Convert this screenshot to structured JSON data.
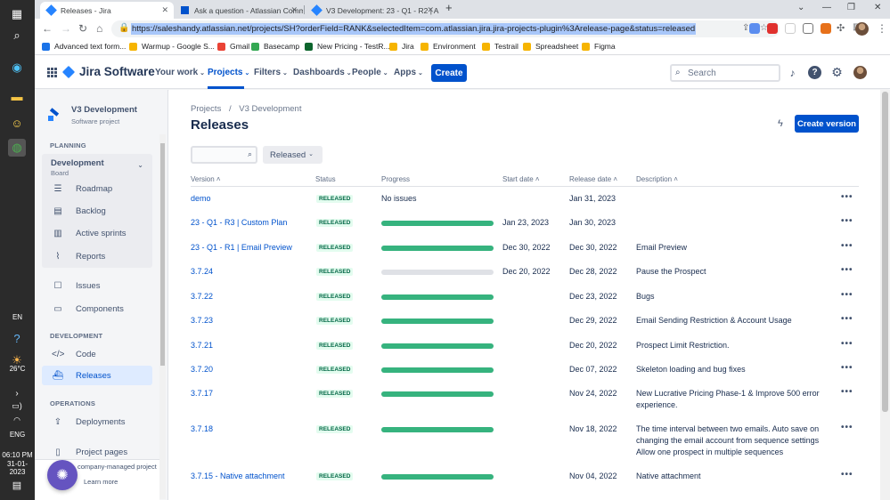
{
  "taskbar": {
    "weather": "26°C",
    "lang": "EN",
    "lang2": "ENG",
    "time": "06:10 PM",
    "date": "31-01-2023"
  },
  "browser": {
    "tabs": [
      {
        "label": "Releases - Jira",
        "active": true
      },
      {
        "label": "Ask a question - Atlassian Comm",
        "active": false
      },
      {
        "label": "V3 Development: 23 - Q1 - R2 | A",
        "active": false
      }
    ],
    "url": "https://saleshandy.atlassian.net/projects/SH?orderField=RANK&selectedItem=com.atlassian.jira.jira-projects-plugin%3Arelease-page&status=released",
    "bookmarks": [
      "Advanced text form...",
      "Warmup - Google S...",
      "Gmail",
      "Basecamp",
      "New Pricing - TestR...",
      "Jira",
      "Environment",
      "Testrail",
      "Spreadsheet",
      "Figma"
    ]
  },
  "topnav": {
    "product": "Jira Software",
    "menus": [
      "Your work",
      "Projects",
      "Filters",
      "Dashboards",
      "People",
      "Apps"
    ],
    "active_menu": "Projects",
    "create_label": "Create",
    "search_placeholder": "Search"
  },
  "sidebar": {
    "project_name": "V3 Development",
    "project_type": "Software project",
    "planning_label": "PLANNING",
    "board_name": "Development",
    "board_sub": "Board",
    "planning_items": [
      {
        "label": "Roadmap",
        "icon": "roadmap-icon"
      },
      {
        "label": "Backlog",
        "icon": "backlog-icon"
      },
      {
        "label": "Active sprints",
        "icon": "sprints-icon"
      },
      {
        "label": "Reports",
        "icon": "reports-icon"
      }
    ],
    "other_items": [
      {
        "label": "Issues",
        "icon": "issues-icon"
      },
      {
        "label": "Components",
        "icon": "components-icon"
      }
    ],
    "development_label": "DEVELOPMENT",
    "development_items": [
      {
        "label": "Code",
        "icon": "code-icon"
      },
      {
        "label": "Releases",
        "icon": "releases-icon",
        "selected": true
      }
    ],
    "operations_label": "OPERATIONS",
    "operations_items": [
      {
        "label": "Deployments",
        "icon": "deployments-icon"
      },
      {
        "label": "Project pages",
        "icon": "pages-icon"
      }
    ],
    "footer_text": "company-managed project",
    "learn_more": "Learn more"
  },
  "main": {
    "breadcrumb": [
      "Projects",
      "V3 Development"
    ],
    "title": "Releases",
    "create_version_label": "Create version",
    "status_filter": "Released",
    "columns": [
      "Version",
      "Status",
      "Progress",
      "Start date",
      "Release date",
      "Description"
    ],
    "rows": [
      {
        "version": "demo",
        "status": "RELEASED",
        "progress": null,
        "progress_text": "No issues",
        "start": "",
        "release": "Jan 31, 2023",
        "description": ""
      },
      {
        "version": "23 - Q1 - R3 | Custom Plan",
        "status": "RELEASED",
        "progress": 1.0,
        "start": "Jan 23, 2023",
        "release": "Jan 30, 2023",
        "description": ""
      },
      {
        "version": "23 - Q1 - R1 | Email Preview",
        "status": "RELEASED",
        "progress": 1.0,
        "start": "Dec 30, 2022",
        "release": "Dec 30, 2022",
        "description": "Email Preview"
      },
      {
        "version": "3.7.24",
        "status": "RELEASED",
        "progress": 0.0,
        "start": "Dec 20, 2022",
        "release": "Dec 28, 2022",
        "description": "Pause the Prospect"
      },
      {
        "version": "3.7.22",
        "status": "RELEASED",
        "progress": 1.0,
        "start": "",
        "release": "Dec 23, 2022",
        "description": "Bugs"
      },
      {
        "version": "3.7.23",
        "status": "RELEASED",
        "progress": 1.0,
        "start": "",
        "release": "Dec 29, 2022",
        "description": "Email Sending Restriction & Account Usage"
      },
      {
        "version": "3.7.21",
        "status": "RELEASED",
        "progress": 1.0,
        "start": "",
        "release": "Dec 20, 2022",
        "description": "Prospect Limit Restriction."
      },
      {
        "version": "3.7.20",
        "status": "RELEASED",
        "progress": 1.0,
        "start": "",
        "release": "Dec 07, 2022",
        "description": "Skeleton loading and bug fixes"
      },
      {
        "version": "3.7.17",
        "status": "RELEASED",
        "progress": 1.0,
        "start": "",
        "release": "Nov 24, 2022",
        "description": "New Lucrative Pricing Phase-1 & Improve 500 error experience."
      },
      {
        "version": "3.7.18",
        "status": "RELEASED",
        "progress": 1.0,
        "start": "",
        "release": "Nov 18, 2022",
        "description": "The time interval between two emails. Auto save on changing the email account from sequence settings Allow one prospect in multiple sequences"
      },
      {
        "version": "3.7.15 - Native attachment",
        "status": "RELEASED",
        "progress": 1.0,
        "start": "",
        "release": "Nov 04, 2022",
        "description": "Native attachment"
      }
    ],
    "colors": {
      "done": "#36b37e",
      "empty": "#dfe1e6",
      "link": "#0052cc"
    }
  }
}
